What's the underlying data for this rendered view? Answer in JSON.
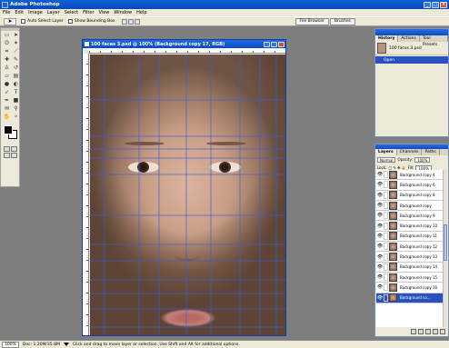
{
  "app": {
    "title": "Adobe Photoshop"
  },
  "menu": [
    "File",
    "Edit",
    "Image",
    "Layer",
    "Select",
    "Filter",
    "View",
    "Window",
    "Help"
  ],
  "options": {
    "auto_select_label": "Auto Select Layer",
    "show_bounding_label": "Show Bounding Box"
  },
  "well": {
    "file_browser": "File Browser",
    "brushes": "Brushes"
  },
  "document": {
    "title": "100 faces 3.psd @ 100% (Background copy 17, RGB)"
  },
  "history": {
    "tabs": [
      "History",
      "Actions",
      "Tool Presets"
    ],
    "snapshot": "100 faces 3.psd",
    "open": "Open"
  },
  "layers": {
    "tabs": [
      "Layers",
      "Channels",
      "Paths"
    ],
    "blend_mode": "Normal",
    "opacity_label": "Opacity:",
    "opacity_value": "100%",
    "lock_label": "Lock:",
    "fill_label": "Fill:",
    "fill_value": "100%",
    "items": [
      "Background copy 4",
      "Background copy 6",
      "Background copy 8",
      "Background copy",
      "Background copy 9",
      "Background copy 10",
      "Background copy 11",
      "Background copy 12",
      "Background copy 13",
      "Background copy 14",
      "Background copy 15",
      "Background copy 16",
      "Background co..."
    ],
    "active_index": 12
  },
  "status": {
    "zoom": "100%",
    "doc": "Doc: 1.20M/35.8M",
    "hint": "Click and drag to move layer or selection. Use Shift and Alt for additional options."
  },
  "colors": {
    "guide": "#3a5de0",
    "selection": "#2a52be",
    "title_bar": "#0a5fd8"
  }
}
